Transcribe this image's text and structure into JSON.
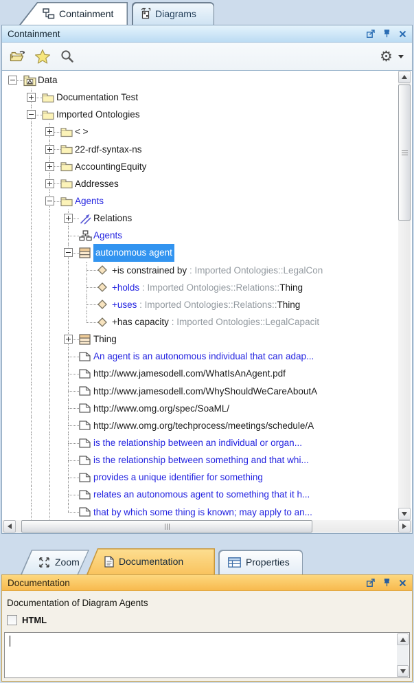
{
  "top_tabs": [
    {
      "label": "Containment",
      "icon": "containment-tree-icon",
      "active": true
    },
    {
      "label": "Diagrams",
      "icon": "diagrams-icon",
      "active": false
    }
  ],
  "containment_panel": {
    "title": "Containment",
    "window_icons": [
      "float-icon",
      "pin-icon",
      "close-icon"
    ],
    "toolbar_icons": [
      "open-project-icon",
      "favorites-star-icon",
      "search-icon",
      "gear-icon",
      "dropdown-arrow-icon"
    ],
    "tree": [
      {
        "level": 0,
        "expander": "minus",
        "icon": "model",
        "label": "Data",
        "color": "k"
      },
      {
        "level": 1,
        "expander": "plus",
        "icon": "folder",
        "label": "Documentation Test",
        "color": "k"
      },
      {
        "level": 1,
        "expander": "minus",
        "icon": "folder",
        "label": "Imported Ontologies",
        "color": "k"
      },
      {
        "level": 2,
        "expander": "plus",
        "icon": "folder",
        "label": "< >",
        "color": "k"
      },
      {
        "level": 2,
        "expander": "plus",
        "icon": "folder",
        "label": "22-rdf-syntax-ns",
        "color": "k"
      },
      {
        "level": 2,
        "expander": "plus",
        "icon": "folder",
        "label": "AccountingEquity",
        "color": "k"
      },
      {
        "level": 2,
        "expander": "plus",
        "icon": "folder",
        "label": "Addresses",
        "color": "k"
      },
      {
        "level": 2,
        "expander": "minus",
        "icon": "folder",
        "label": "Agents",
        "color": "b"
      },
      {
        "level": 3,
        "expander": "plus",
        "icon": "relations",
        "label": "Relations",
        "color": "k"
      },
      {
        "level": 3,
        "expander": null,
        "icon": "diagram",
        "label": "Agents",
        "color": "b"
      },
      {
        "level": 3,
        "expander": "minus",
        "icon": "class",
        "label": "autonomous agent",
        "color": "k",
        "selected": true
      },
      {
        "level": 4,
        "expander": null,
        "icon": "diamond",
        "parts": [
          {
            "t": "+is constrained by",
            "c": "k"
          },
          {
            "t": " : ",
            "c": "g"
          },
          {
            "t": "Imported Ontologies::LegalCon",
            "c": "g"
          }
        ]
      },
      {
        "level": 4,
        "expander": null,
        "icon": "diamond",
        "parts": [
          {
            "t": "+holds",
            "c": "b"
          },
          {
            "t": " : ",
            "c": "g"
          },
          {
            "t": "Imported Ontologies::Relations::",
            "c": "g"
          },
          {
            "t": "Thing",
            "c": "k"
          }
        ]
      },
      {
        "level": 4,
        "expander": null,
        "icon": "diamond",
        "parts": [
          {
            "t": "+uses",
            "c": "b"
          },
          {
            "t": " : ",
            "c": "g"
          },
          {
            "t": "Imported Ontologies::Relations::",
            "c": "g"
          },
          {
            "t": "Thing",
            "c": "k"
          }
        ]
      },
      {
        "level": 4,
        "expander": null,
        "icon": "diamond",
        "parts": [
          {
            "t": "+has capacity",
            "c": "k"
          },
          {
            "t": " : ",
            "c": "g"
          },
          {
            "t": "Imported Ontologies::LegalCapacit",
            "c": "g"
          }
        ]
      },
      {
        "level": 3,
        "expander": "plus",
        "icon": "class",
        "label": "Thing",
        "color": "k"
      },
      {
        "level": 3,
        "expander": null,
        "icon": "document",
        "label": "An agent is an autonomous individual that can adap...",
        "color": "b"
      },
      {
        "level": 3,
        "expander": null,
        "icon": "document",
        "label": "http://www.jamesodell.com/WhatIsAnAgent.pdf",
        "color": "k"
      },
      {
        "level": 3,
        "expander": null,
        "icon": "document",
        "label": "http://www.jamesodell.com/WhyShouldWeCareAboutA",
        "color": "k"
      },
      {
        "level": 3,
        "expander": null,
        "icon": "document",
        "label": "http://www.omg.org/spec/SoaML/",
        "color": "k"
      },
      {
        "level": 3,
        "expander": null,
        "icon": "document",
        "label": "http://www.omg.org/techprocess/meetings/schedule/A",
        "color": "k"
      },
      {
        "level": 3,
        "expander": null,
        "icon": "document",
        "label": "is the relationship between an individual or organ...",
        "color": "b"
      },
      {
        "level": 3,
        "expander": null,
        "icon": "document",
        "label": "is the relationship between something and that whi...",
        "color": "b"
      },
      {
        "level": 3,
        "expander": null,
        "icon": "document",
        "label": "provides a unique identifier for something",
        "color": "b"
      },
      {
        "level": 3,
        "expander": null,
        "icon": "document",
        "label": "relates an autonomous agent to something that it h...",
        "color": "b"
      },
      {
        "level": 3,
        "expander": null,
        "icon": "document",
        "label": "that by which some thing is known; may apply to an...",
        "color": "b"
      }
    ]
  },
  "bottom_tabs": [
    {
      "label": "Zoom",
      "icon": "zoom-icon",
      "active": false
    },
    {
      "label": "Documentation",
      "icon": "documentation-icon",
      "active": true
    },
    {
      "label": "Properties",
      "icon": "properties-icon",
      "active": false
    }
  ],
  "documentation_panel": {
    "title": "Documentation",
    "window_icons": [
      "float-icon",
      "pin-icon",
      "close-icon"
    ],
    "subtitle": "Documentation of Diagram Agents",
    "checkbox_label": "HTML",
    "checkbox_checked": false,
    "editor_value": ""
  },
  "colors": {
    "selection_blue": "#3294f0",
    "element_link_blue": "#2323e0",
    "muted_gray_text": "#939aa0",
    "panel_header_blue": "#bcdcf3",
    "doc_header_orange": "#f8ba4e",
    "folder_yellow": "#fcf3b8",
    "desktop_background": "#cddcec"
  }
}
